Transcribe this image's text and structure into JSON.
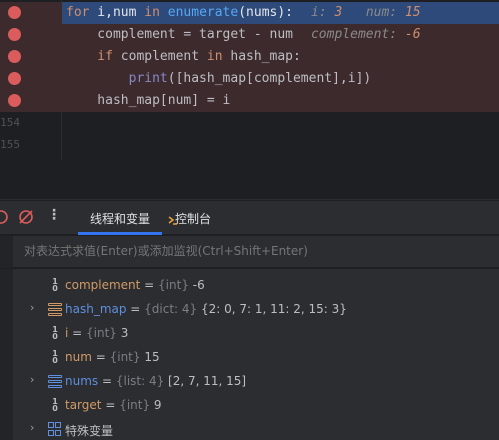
{
  "editor": {
    "lines": [
      {
        "num": "",
        "type": "exec",
        "breakpoint": true
      },
      {
        "num": "",
        "type": "bp",
        "breakpoint": true
      },
      {
        "num": "",
        "type": "bp",
        "breakpoint": true
      },
      {
        "num": "",
        "type": "bp",
        "breakpoint": true
      },
      {
        "num": "",
        "type": "bp",
        "breakpoint": true
      },
      {
        "num": "154",
        "type": "plain",
        "breakpoint": false
      },
      {
        "num": "155",
        "type": "plain",
        "breakpoint": false
      }
    ],
    "code": {
      "l1_kw1": "for",
      "l1_vars": " i,num ",
      "l1_kw2": "in",
      "l1_fn": " enumerate",
      "l1_rest": "(nums):",
      "l1_hint_i_label": "i:",
      "l1_hint_i_val": "3",
      "l1_hint_num_label": "num:",
      "l1_hint_num_val": "15",
      "l2": "    complement = target - num",
      "l2_hint_label": "complement:",
      "l2_hint_val": "-6",
      "l3_kw": "    if",
      "l3_mid": " complement ",
      "l3_kw2": "in",
      "l3_rest": " hash_map:",
      "l4_bi": "        print",
      "l4_rest": "([hash_map[complement],i])",
      "l5": "    hash_map[num] = i"
    }
  },
  "toolbar": {
    "tab_threads": "线程和变量",
    "tab_console": "控制台",
    "more": "⋮"
  },
  "eval": {
    "placeholder": "对表达式求值(Enter)或添加监视(Ctrl+Shift+Enter)"
  },
  "variables": [
    {
      "name": "complement",
      "eq": " = ",
      "type": "{int}",
      "value": " -6",
      "icon": "int-icon",
      "expandable": false,
      "selected": true
    },
    {
      "name": "hash_map",
      "eq": " = ",
      "type": "{dict: 4}",
      "value": " {2: 0, 7: 1, 11: 2, 15: 3}",
      "icon": "dict-icon",
      "expandable": true,
      "selected": false
    },
    {
      "name": "i",
      "eq": " = ",
      "type": "{int}",
      "value": " 3",
      "icon": "int-icon",
      "expandable": false,
      "selected": false
    },
    {
      "name": "num",
      "eq": " = ",
      "type": "{int}",
      "value": " 15",
      "icon": "int-icon",
      "expandable": false,
      "selected": false
    },
    {
      "name": "nums",
      "eq": " = ",
      "type": "{list: 4}",
      "value": " [2, 7, 11, 15]",
      "icon": "list-icon",
      "expandable": true,
      "selected": false
    },
    {
      "name": "target",
      "eq": " = ",
      "type": "{int}",
      "value": " 9",
      "icon": "int-icon",
      "expandable": false,
      "selected": false
    },
    {
      "name": "特殊变量",
      "eq": "",
      "type": "",
      "value": "",
      "icon": "special-vars-icon",
      "expandable": true,
      "selected": false
    }
  ],
  "colors": {
    "accent": "#3574f0",
    "breakpoint": "#db5c5c",
    "exec_line": "#2e4a7a",
    "bp_line": "#3d2a2c"
  }
}
